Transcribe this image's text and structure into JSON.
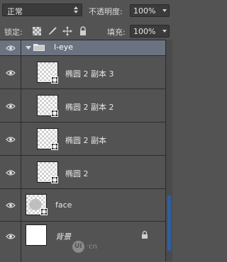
{
  "toolbar": {
    "blend_mode": "正常",
    "opacity_label": "不透明度:",
    "opacity_value": "100%",
    "lock_label": "锁定:",
    "fill_label": "填充:",
    "fill_value": "100%"
  },
  "group": {
    "name": "l-eye",
    "expanded": true
  },
  "layers": [
    {
      "name": "椭圆 2 副本 3",
      "thumb": "transparent",
      "has_shape_badge": true
    },
    {
      "name": "椭圆 2 副本 2",
      "thumb": "transparent",
      "has_shape_badge": true
    },
    {
      "name": "椭圆 2 副本",
      "thumb": "transparent",
      "has_shape_badge": true
    },
    {
      "name": "椭圆 2",
      "thumb": "transparent",
      "has_shape_badge": true
    },
    {
      "name": "face",
      "thumb": "face",
      "has_shape_badge": true
    },
    {
      "name": "背景",
      "thumb": "white",
      "has_shape_badge": false,
      "locked": true
    }
  ],
  "watermark": {
    "logo_text": "UI",
    "text": "·cn"
  },
  "colors": {
    "panel_bg": "#535353",
    "group_highlight": "#6b7380",
    "scroll_accent": "#2d5f9e"
  },
  "icons": [
    "chevron-updown-icon",
    "dropdown-arrow-icon",
    "lock-transparent-icon",
    "lock-brush-icon",
    "lock-move-icon",
    "lock-all-icon",
    "eye-icon",
    "folder-icon",
    "shape-badge-icon",
    "lock-icon"
  ]
}
